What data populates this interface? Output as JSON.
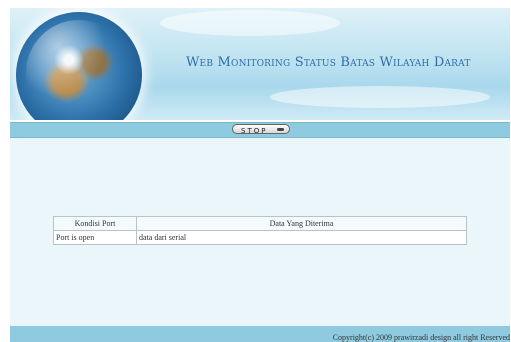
{
  "header": {
    "title": "Web Monitoring Status Batas Wilayah Darat"
  },
  "controls": {
    "stop_label": "STOP"
  },
  "table": {
    "columns": [
      "Kondisi Port",
      "Data Yang Diterima"
    ],
    "rows": [
      [
        "Port is open",
        "data dari serial"
      ]
    ]
  },
  "footer": {
    "copyright": "Copyright(c) 2009 prawirzadi design all right Reserved"
  },
  "colors": {
    "banner_text": "#2f6ea8",
    "bar": "#8fcbe0",
    "page_bg": "#eaf6f9"
  }
}
